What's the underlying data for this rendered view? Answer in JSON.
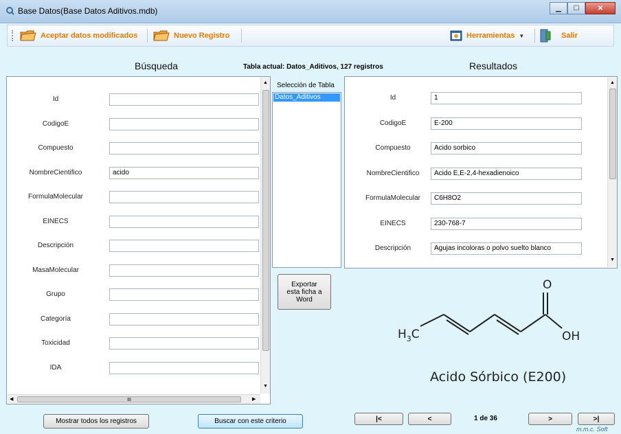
{
  "window": {
    "title": "Base Datos(Base Datos Aditivos.mdb)"
  },
  "toolbar": {
    "accept_label": "Aceptar datos modificados",
    "new_label": "Nuevo Registro",
    "tools_label": "Herramientas",
    "exit_label": "Salir"
  },
  "search": {
    "header": "Búsqueda",
    "fields": [
      {
        "label": "Id",
        "value": ""
      },
      {
        "label": "CodigoE",
        "value": ""
      },
      {
        "label": "Compuesto",
        "value": ""
      },
      {
        "label": "NombreCientifico",
        "value": "acido"
      },
      {
        "label": "FormulaMolecular",
        "value": ""
      },
      {
        "label": "EINECS",
        "value": ""
      },
      {
        "label": "Descripción",
        "value": ""
      },
      {
        "label": "MasaMolecular",
        "value": ""
      },
      {
        "label": "Grupo",
        "value": ""
      },
      {
        "label": "Categoría",
        "value": ""
      },
      {
        "label": "Toxicidad",
        "value": ""
      },
      {
        "label": "IDA",
        "value": ""
      }
    ],
    "hscroll_glyph": "III"
  },
  "current_table": "Tabla actual: Datos_Aditivos, 127 registros",
  "table_selection": {
    "label": "Selección de Tabla",
    "items": [
      "Datos_Aditivos"
    ]
  },
  "export_button": "Exportar esta ficha a Word",
  "results": {
    "header": "Resultados",
    "fields": [
      {
        "label": "Id",
        "value": "1"
      },
      {
        "label": "CodigoE",
        "value": "E-200"
      },
      {
        "label": "Compuesto",
        "value": "Acido sorbico"
      },
      {
        "label": "NombreCientifico",
        "value": "Acido E,E-2,4-hexadienoico"
      },
      {
        "label": "FormulaMolecular",
        "value": "C6H8O2"
      },
      {
        "label": "EINECS",
        "value": "230-768-7"
      },
      {
        "label": "Descripción",
        "value": "Agujas incoloras o polvo suelto blanco"
      }
    ]
  },
  "structure": {
    "caption": "Acido Sórbico (E200)",
    "o_label": "O",
    "oh_label": "OH",
    "h3c_main": "H",
    "h3c_sub": "3",
    "h3c_c": "C"
  },
  "buttons": {
    "show_all": "Mostrar todos los registros",
    "search": "Buscar con este criterio"
  },
  "nav": {
    "first": "|<",
    "prev": "<",
    "page": "1 de 36",
    "next": ">",
    "last": ">|"
  },
  "signature": "m.m.c. Soft",
  "colors": {
    "accent": "#e07a00",
    "background": "#dff4fb"
  }
}
